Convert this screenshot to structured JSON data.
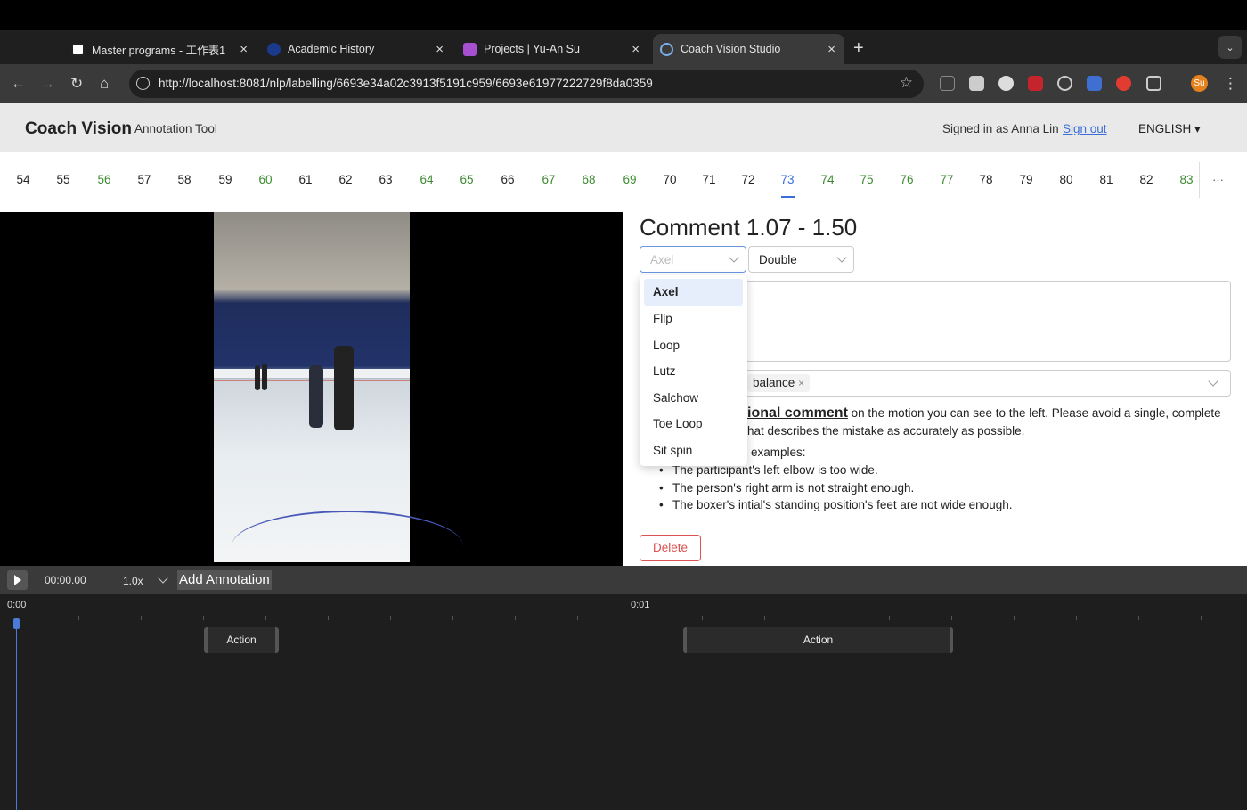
{
  "browser": {
    "tabs": [
      {
        "title": "Master programs - 工作表1",
        "close": "×"
      },
      {
        "title": "Academic History",
        "close": "×"
      },
      {
        "title": "Projects | Yu-An Su",
        "close": "×"
      },
      {
        "title": "Coach Vision Studio",
        "close": "×"
      }
    ],
    "new_tab": "+",
    "tab_menu": "⌄",
    "nav": {
      "back": "←",
      "forward": "→",
      "reload": "↻",
      "home": "⌂"
    },
    "url": "http://localhost:8081/nlp/labelling/6693e34a02c3913f5191c959/6693e61977222729f8da0359",
    "info_icon": "i",
    "star": "☆",
    "profile_initials": "Su",
    "menu": "⋮"
  },
  "app": {
    "brand": "Coach Vision",
    "subtitle": "Annotation Tool",
    "signed_in": "Signed in as Anna Lin",
    "sign_out": "Sign out",
    "language": "ENGLISH ▾"
  },
  "frames": {
    "items": [
      {
        "n": "54",
        "status": "default"
      },
      {
        "n": "55",
        "status": "default"
      },
      {
        "n": "56",
        "status": "done"
      },
      {
        "n": "57",
        "status": "default"
      },
      {
        "n": "58",
        "status": "default"
      },
      {
        "n": "59",
        "status": "default"
      },
      {
        "n": "60",
        "status": "done"
      },
      {
        "n": "61",
        "status": "default"
      },
      {
        "n": "62",
        "status": "default"
      },
      {
        "n": "63",
        "status": "default"
      },
      {
        "n": "64",
        "status": "done"
      },
      {
        "n": "65",
        "status": "done"
      },
      {
        "n": "66",
        "status": "default"
      },
      {
        "n": "67",
        "status": "done"
      },
      {
        "n": "68",
        "status": "done"
      },
      {
        "n": "69",
        "status": "done"
      },
      {
        "n": "70",
        "status": "default"
      },
      {
        "n": "71",
        "status": "default"
      },
      {
        "n": "72",
        "status": "default"
      },
      {
        "n": "73",
        "status": "selected"
      },
      {
        "n": "74",
        "status": "done"
      },
      {
        "n": "75",
        "status": "done"
      },
      {
        "n": "76",
        "status": "done"
      },
      {
        "n": "77",
        "status": "done"
      },
      {
        "n": "78",
        "status": "default"
      },
      {
        "n": "79",
        "status": "default"
      },
      {
        "n": "80",
        "status": "default"
      },
      {
        "n": "81",
        "status": "default"
      },
      {
        "n": "82",
        "status": "default"
      },
      {
        "n": "83",
        "status": "done"
      }
    ],
    "more": "···"
  },
  "comment": {
    "title": "Comment 1.07 - 1.50",
    "jump_select": {
      "placeholder": "Axel"
    },
    "rotation_select": {
      "value": "Double"
    },
    "dropdown_options": [
      "Axel",
      "Flip",
      "Loop",
      "Lutz",
      "Salchow",
      "Toe Loop",
      "Sit spin"
    ],
    "tag": "balance",
    "tag_remove": "×",
    "instruction_em": "ional comment",
    "instruction_rest": " on the motion you can see to the left. Please avoid a single, complete",
    "instruction_line2": "hat describes the mistake as accurately as possible.",
    "examples_label": "examples:",
    "examples": [
      "The participant's left elbow is too wide.",
      "The person's right arm is not straight enough.",
      "The boxer's intial's standing position's feet are not wide enough."
    ],
    "delete_label": "Delete"
  },
  "player": {
    "time": "00:00.00",
    "speed": "1.0x",
    "add_annotation": "Add Annotation"
  },
  "timeline": {
    "labels": [
      "0:00",
      "0:01"
    ],
    "blocks": [
      {
        "label": "Action"
      },
      {
        "label": "Action"
      }
    ]
  },
  "colors": {
    "accent": "#3a6fd8",
    "done": "#3a8a2e",
    "danger": "#d9534f"
  }
}
